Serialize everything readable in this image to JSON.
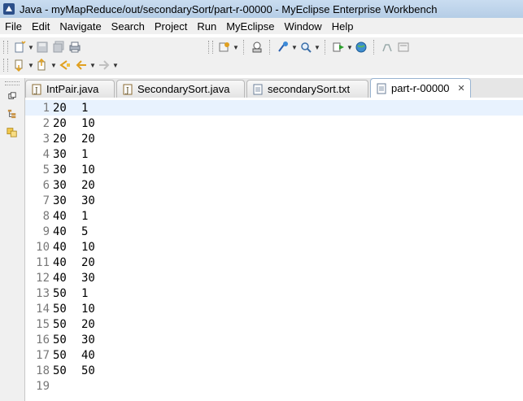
{
  "window": {
    "title": "Java - myMapReduce/out/secondarySort/part-r-00000 - MyEclipse Enterprise Workbench"
  },
  "menu": [
    "File",
    "Edit",
    "Navigate",
    "Search",
    "Project",
    "Run",
    "MyEclipse",
    "Window",
    "Help"
  ],
  "tabs": [
    {
      "label": "IntPair.java",
      "icon": "java-file-icon",
      "active": false
    },
    {
      "label": "SecondarySort.java",
      "icon": "java-file-icon",
      "active": false
    },
    {
      "label": "secondarySort.txt",
      "icon": "text-file-icon",
      "active": false
    },
    {
      "label": "part-r-00000",
      "icon": "text-file-icon",
      "active": true,
      "close": "✕"
    }
  ],
  "editor": {
    "lines": [
      {
        "n": "1",
        "a": "20",
        "b": "1"
      },
      {
        "n": "2",
        "a": "20",
        "b": "10"
      },
      {
        "n": "3",
        "a": "20",
        "b": "20"
      },
      {
        "n": "4",
        "a": "30",
        "b": "1"
      },
      {
        "n": "5",
        "a": "30",
        "b": "10"
      },
      {
        "n": "6",
        "a": "30",
        "b": "20"
      },
      {
        "n": "7",
        "a": "30",
        "b": "30"
      },
      {
        "n": "8",
        "a": "40",
        "b": "1"
      },
      {
        "n": "9",
        "a": "40",
        "b": "5"
      },
      {
        "n": "10",
        "a": "40",
        "b": "10"
      },
      {
        "n": "11",
        "a": "40",
        "b": "20"
      },
      {
        "n": "12",
        "a": "40",
        "b": "30"
      },
      {
        "n": "13",
        "a": "50",
        "b": "1"
      },
      {
        "n": "14",
        "a": "50",
        "b": "10"
      },
      {
        "n": "15",
        "a": "50",
        "b": "20"
      },
      {
        "n": "16",
        "a": "50",
        "b": "30"
      },
      {
        "n": "17",
        "a": "50",
        "b": "40"
      },
      {
        "n": "18",
        "a": "50",
        "b": "50"
      },
      {
        "n": "19",
        "a": "",
        "b": ""
      }
    ]
  },
  "colors": {
    "titlebar": "#c9dcf0",
    "current_line": "#e8f2fe",
    "line_number": "#787878"
  }
}
